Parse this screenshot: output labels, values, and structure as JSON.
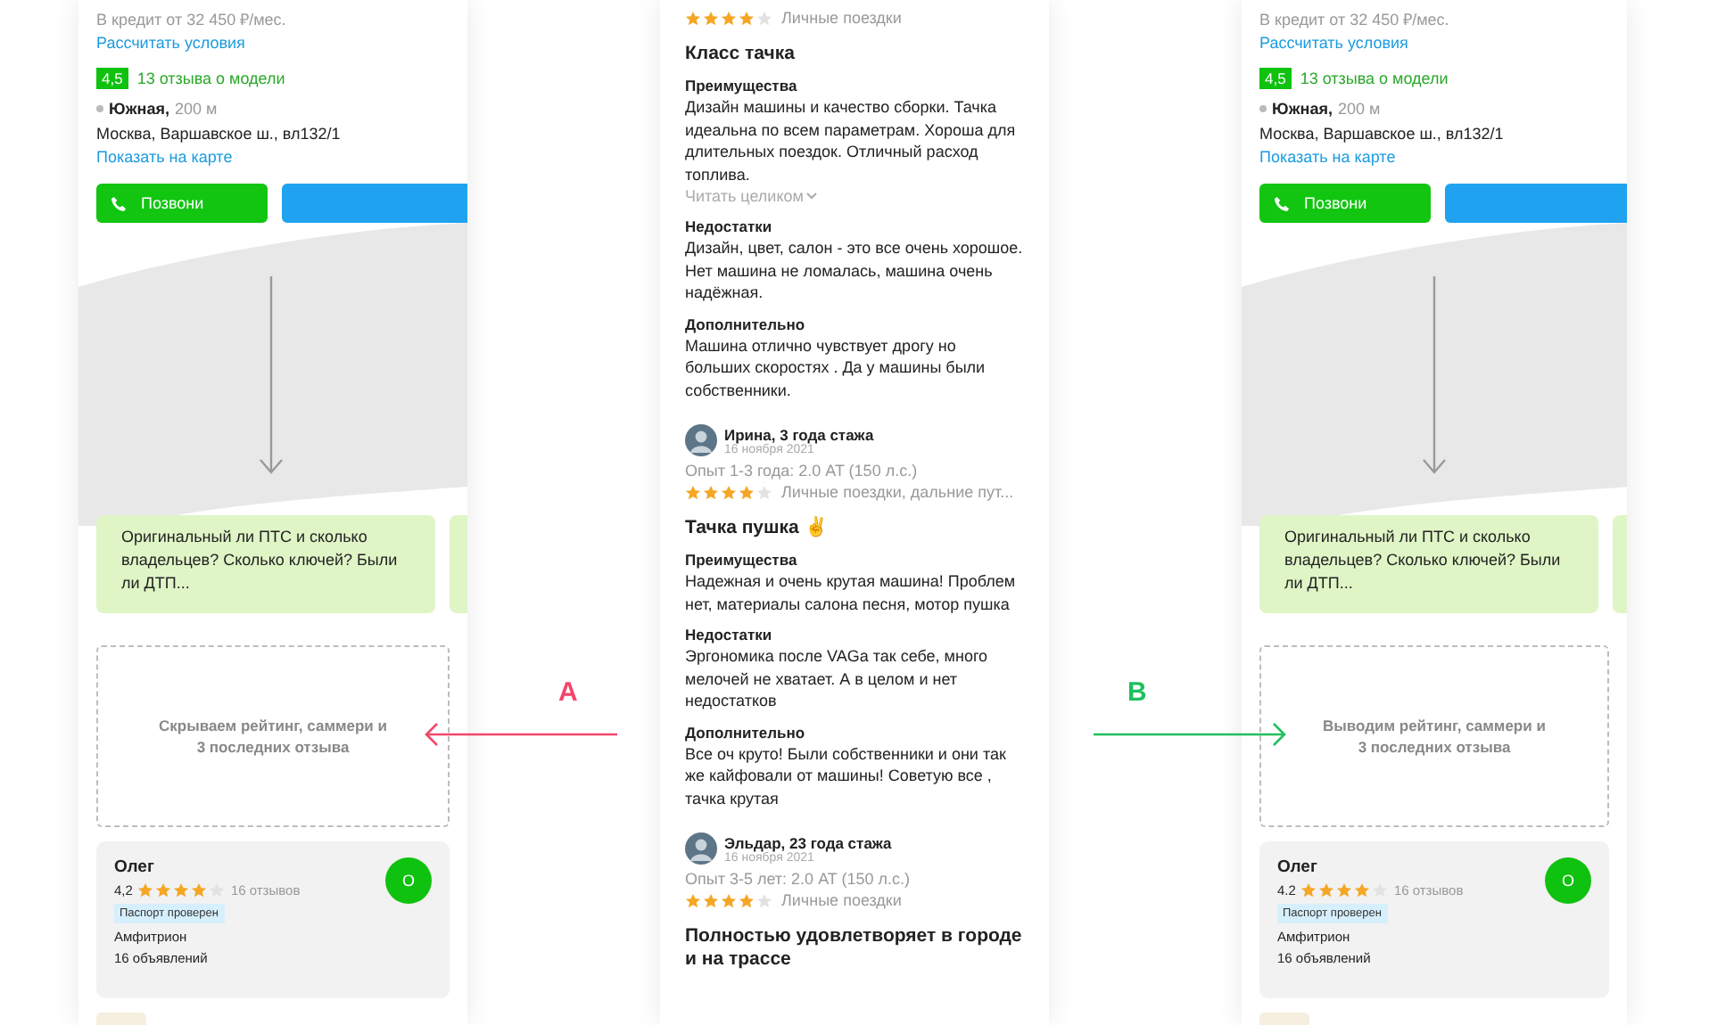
{
  "screens": [
    {
      "kind": "listing",
      "credit": "В кредит от 32 450 ₽/мес.",
      "calc_link": "Рассчитать условия",
      "rating_badge": "4,5",
      "reviews_link": "13 отзыва о модели",
      "metro_station": "Южная,",
      "metro_distance": "200 м",
      "address": "Москва, Варшавское ш., вл132/1",
      "map_link": "Показать на карте",
      "call_button": "Позвони",
      "info_card": "Оригинальный ли ПТС и сколько владельцев? Сколько ключей? Были ли ДТП...",
      "note": "Скрываем рейтинг, саммери и 3 последних отзыва",
      "seller": {
        "name": "Олег",
        "rating": "4,2",
        "stars": 4,
        "reviews": "16 отзывов",
        "badge": "Паспорт проверен",
        "company": "Амфитрион",
        "listings": "16 объявлений",
        "avatar": "О"
      }
    },
    {
      "kind": "reviews",
      "reviews": [
        {
          "stars": 4,
          "tags": "Личные поездки",
          "title": "Класс тачка",
          "sections": [
            {
              "heading": "Преимущества",
              "text": "Дизайн машины и качество сборки. Тачка идеальна по всем параметрам. Хороша для длительных поездок. Отличный расход топлива.",
              "more": "Читать целиком"
            },
            {
              "heading": "Недостатки",
              "text": "Дизайн, цвет, салон - это все очень хорошое. Нет машина не ломалась, машина очень надёжная."
            },
            {
              "heading": "Дополнительно",
              "text": "Машина отлично чувствует дрогу но больших скоростях . Да у машины были собственники."
            }
          ]
        },
        {
          "author": "Ирина, 3 года стажа",
          "date": "16 ноября 2021",
          "experience": "Опыт 1-3 года: 2.0 AT (150 л.с.)",
          "stars": 4,
          "tags": "Личные поездки, дальние пут...",
          "title": "Тачка пушка",
          "emoji": "✌",
          "sections": [
            {
              "heading": "Преимущества",
              "text": "Надежная и очень крутая машина! Проблем нет, материалы салона песня, мотор пушка"
            },
            {
              "heading": "Недостатки",
              "text": "Эргономика после VAGa так себе, много мелочей не хватает. А в целом и нет недостатков"
            },
            {
              "heading": "Дополнительно",
              "text": "Все оч круто! Были собственники и они так же кайфовали от машины! Советую все , тачка крутая"
            }
          ]
        },
        {
          "author": "Эльдар, 23 года стажа",
          "date": "16 ноября 2021",
          "experience": "Опыт 3-5 лет: 2.0 AT (150 л.с.)",
          "stars": 4,
          "tags": "Личные поездки",
          "title": "Полностью удовлетворяет в городе и на трассе"
        }
      ]
    },
    {
      "kind": "listing",
      "credit": "В кредит от 32 450 ₽/мес.",
      "calc_link": "Рассчитать условия",
      "rating_badge": "4,5",
      "reviews_link": "13 отзыва о модели",
      "metro_station": "Южная,",
      "metro_distance": "200 м",
      "address": "Москва, Варшавское ш., вл132/1",
      "map_link": "Показать на карте",
      "call_button": "Позвони",
      "info_card": "Оригинальный ли ПТС и сколько владельцев? Сколько ключей? Были ли ДТП...",
      "note": "Выводим рейтинг, саммери и 3 последних отзыва",
      "seller": {
        "name": "Олег",
        "rating": "4.2",
        "stars": 4,
        "reviews": "16 отзывов",
        "badge": "Паспорт проверен",
        "company": "Амфитрион",
        "listings": "16 объявлений",
        "avatar": "О"
      }
    }
  ],
  "annotations": [
    {
      "label": "A",
      "color": "#f2476a",
      "kind": "left"
    },
    {
      "label": "B",
      "color": "#1fbf5e",
      "kind": "right"
    }
  ]
}
